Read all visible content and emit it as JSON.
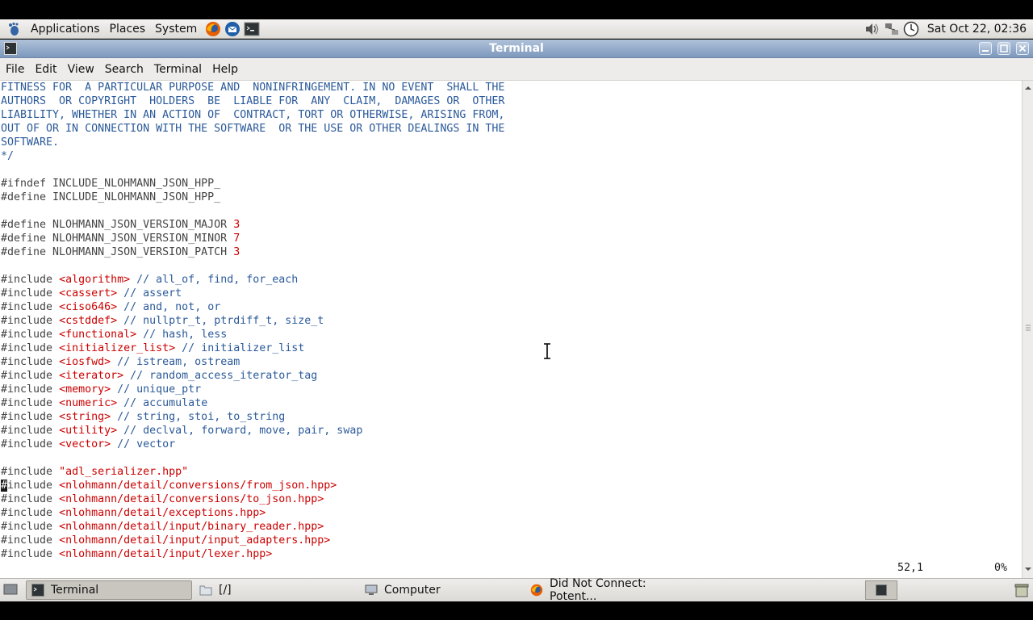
{
  "top_panel": {
    "menus": [
      "Applications",
      "Places",
      "System"
    ],
    "clock": "Sat Oct 22, 02:36"
  },
  "window": {
    "title": "Terminal",
    "menubar": [
      "File",
      "Edit",
      "View",
      "Search",
      "Terminal",
      "Help"
    ]
  },
  "editor": {
    "license_lines": [
      "FITNESS FOR  A PARTICULAR PURPOSE AND  NONINFRINGEMENT. IN NO EVENT  SHALL THE",
      "AUTHORS  OR COPYRIGHT  HOLDERS  BE  LIABLE FOR  ANY  CLAIM,  DAMAGES OR  OTHER",
      "LIABILITY, WHETHER IN AN ACTION OF  CONTRACT, TORT OR OTHERWISE, ARISING FROM,",
      "OUT OF OR IN CONNECTION WITH THE SOFTWARE  OR THE USE OR OTHER DEALINGS IN THE",
      "SOFTWARE.",
      "*/"
    ],
    "guard": [
      "#ifndef INCLUDE_NLOHMANN_JSON_HPP_",
      "#define INCLUDE_NLOHMANN_JSON_HPP_"
    ],
    "version_defines": [
      {
        "name": "#define NLOHMANN_JSON_VERSION_MAJOR ",
        "value": "3"
      },
      {
        "name": "#define NLOHMANN_JSON_VERSION_MINOR ",
        "value": "7"
      },
      {
        "name": "#define NLOHMANN_JSON_VERSION_PATCH ",
        "value": "3"
      }
    ],
    "std_includes": [
      {
        "header": "<algorithm>",
        "comment": " // all_of, find, for_each"
      },
      {
        "header": "<cassert>",
        "comment": " // assert"
      },
      {
        "header": "<ciso646>",
        "comment": " // and, not, or"
      },
      {
        "header": "<cstddef>",
        "comment": " // nullptr_t, ptrdiff_t, size_t"
      },
      {
        "header": "<functional>",
        "comment": " // hash, less"
      },
      {
        "header": "<initializer_list>",
        "comment": " // initializer_list"
      },
      {
        "header": "<iosfwd>",
        "comment": " // istream, ostream"
      },
      {
        "header": "<iterator>",
        "comment": " // random_access_iterator_tag"
      },
      {
        "header": "<memory>",
        "comment": " // unique_ptr"
      },
      {
        "header": "<numeric>",
        "comment": " // accumulate"
      },
      {
        "header": "<string>",
        "comment": " // string, stoi, to_string"
      },
      {
        "header": "<utility>",
        "comment": " // declval, forward, move, pair, swap"
      },
      {
        "header": "<vector>",
        "comment": " // vector"
      }
    ],
    "local_includes": [
      "\"adl_serializer.hpp\"",
      "<nlohmann/detail/conversions/from_json.hpp>",
      "<nlohmann/detail/conversions/to_json.hpp>",
      "<nlohmann/detail/exceptions.hpp>",
      "<nlohmann/detail/input/binary_reader.hpp>",
      "<nlohmann/detail/input/input_adapters.hpp>",
      "<nlohmann/detail/input/lexer.hpp>"
    ],
    "include_keyword": "#include ",
    "status_position": "52,1",
    "status_percent": "0%"
  },
  "taskbar": {
    "tasks": [
      "Terminal",
      "[/]",
      "Computer",
      "Did Not Connect: Potent..."
    ]
  }
}
